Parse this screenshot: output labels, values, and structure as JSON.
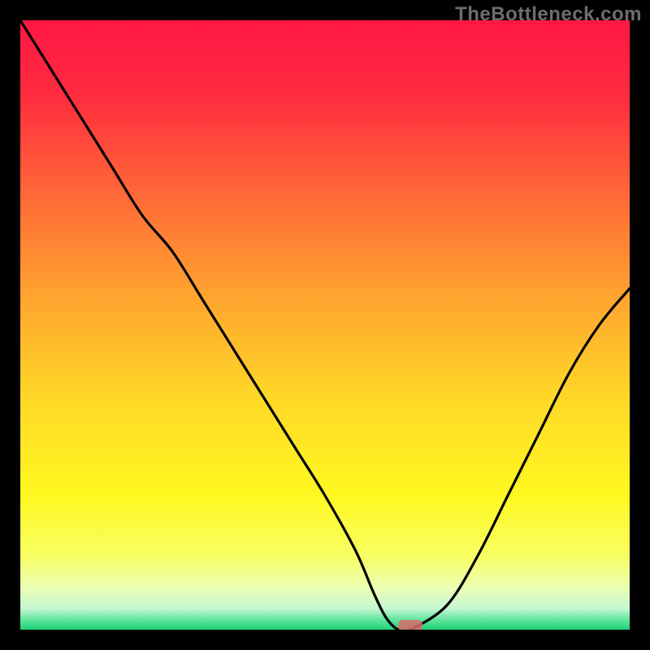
{
  "watermark": "TheBottleneck.com",
  "chart_data": {
    "type": "line",
    "title": "",
    "xlabel": "",
    "ylabel": "",
    "xlim": [
      0,
      100
    ],
    "ylim": [
      0,
      100
    ],
    "x": [
      0,
      5,
      10,
      15,
      20,
      25,
      30,
      35,
      40,
      45,
      50,
      55,
      58,
      60,
      62,
      64,
      70,
      75,
      80,
      85,
      90,
      95,
      100
    ],
    "y": [
      100,
      92,
      84,
      76,
      68,
      62,
      54,
      46,
      38,
      30,
      22,
      13,
      6,
      2,
      0,
      0,
      4,
      12,
      22,
      32,
      42,
      50,
      56
    ],
    "minimum": {
      "x": 63,
      "y": 0
    },
    "marker": {
      "x_range": [
        62,
        66
      ],
      "y": 0
    },
    "gradient_stops": [
      {
        "offset": 0.0,
        "color": "#ff1745"
      },
      {
        "offset": 0.12,
        "color": "#ff2b3f"
      },
      {
        "offset": 0.28,
        "color": "#ff6638"
      },
      {
        "offset": 0.45,
        "color": "#ffa32f"
      },
      {
        "offset": 0.62,
        "color": "#ffd827"
      },
      {
        "offset": 0.78,
        "color": "#fff820"
      },
      {
        "offset": 0.88,
        "color": "#f8ff64"
      },
      {
        "offset": 0.93,
        "color": "#ecffb2"
      },
      {
        "offset": 0.965,
        "color": "#c6f7d3"
      },
      {
        "offset": 0.985,
        "color": "#5be39a"
      },
      {
        "offset": 1.0,
        "color": "#1fd07a"
      }
    ]
  }
}
